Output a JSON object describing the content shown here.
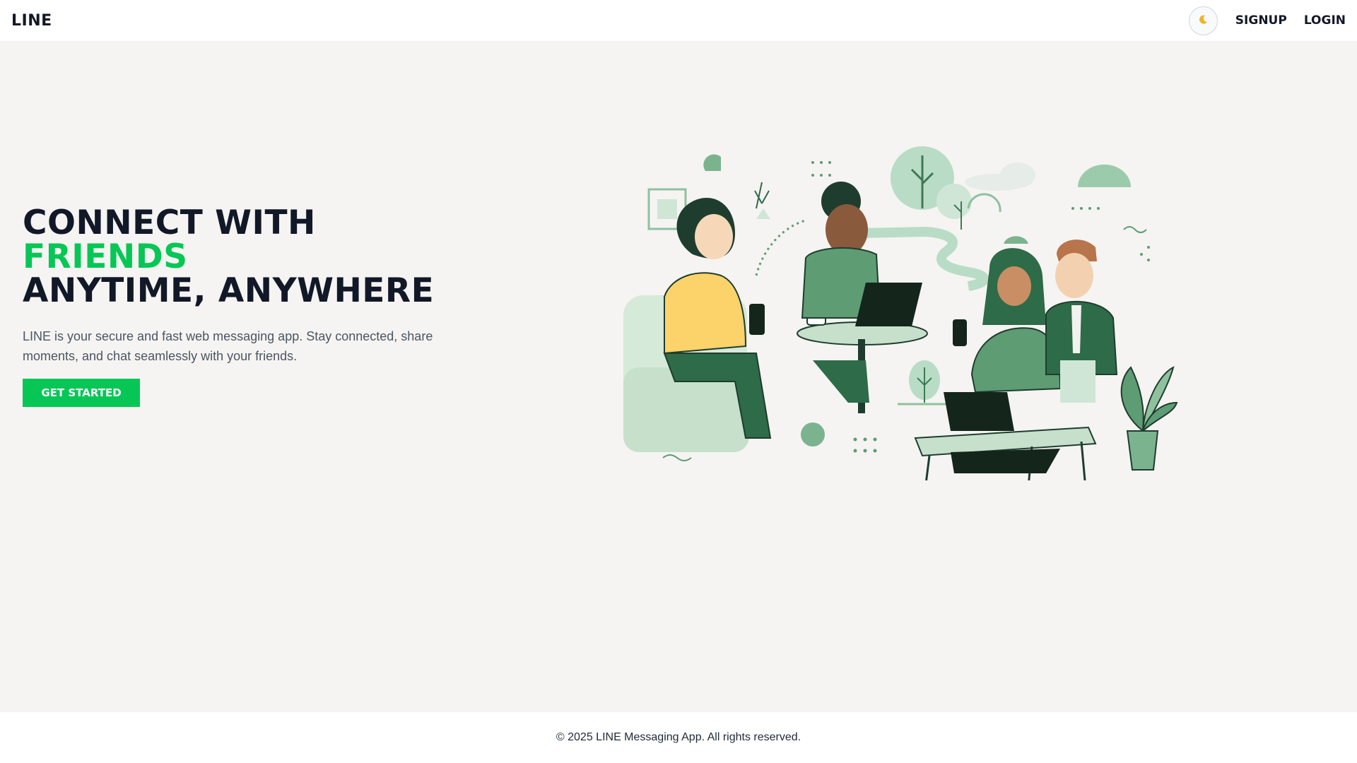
{
  "navbar": {
    "brand": "LINE",
    "theme_toggle_icon": "moon-icon",
    "signup_label": "SIGNUP",
    "login_label": "LOGIN"
  },
  "hero": {
    "headline_line1": "CONNECT WITH",
    "headline_line2": "FRIENDS",
    "headline_line3": "ANYTIME, ANYWHERE",
    "subtitle": "LINE is your secure and fast web messaging app. Stay connected, share moments, and chat seamlessly with your friends.",
    "cta_label": "GET STARTED"
  },
  "footer": {
    "copyright": "© 2025 LINE Messaging App. All rights reserved."
  },
  "colors": {
    "accent": "#06c755",
    "text_dark": "#111827",
    "background": "#f5f4f2",
    "illustration_green": "#3d8a5f"
  }
}
